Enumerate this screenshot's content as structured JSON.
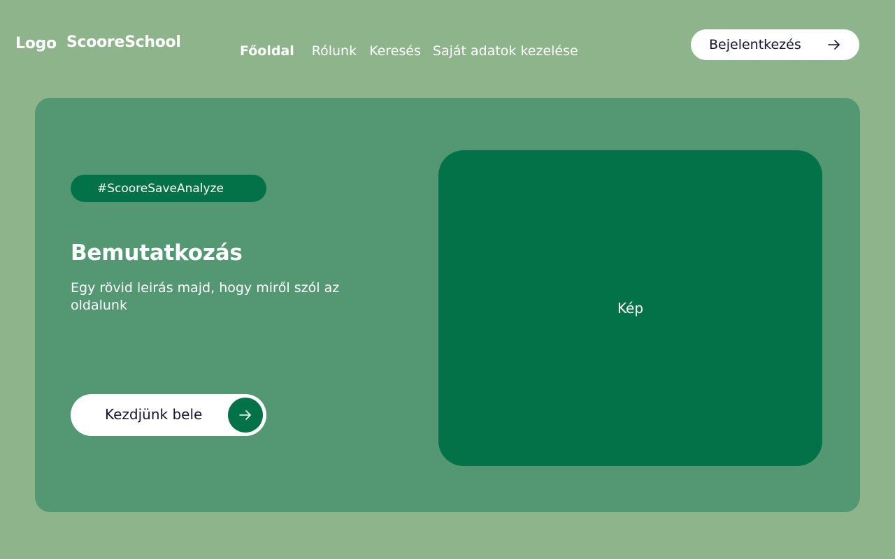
{
  "header": {
    "logo": "Logo",
    "brand": "ScooreSchool",
    "nav": {
      "home": "Főoldal",
      "about": "Rólunk",
      "search": "Keresés",
      "profile": "Saját adatok kezelése"
    },
    "login_label": "Bejelentkezés",
    "login_icon": "arrow-right-icon"
  },
  "hero": {
    "tag": "#ScooreSaveAnalyze",
    "title": "Bemutatkozás",
    "description": "Egy rövid leirás majd, hogy miről szól az oldalunk",
    "cta_label": "Kezdjünk bele",
    "cta_icon": "arrow-right-icon",
    "image_placeholder": "Kép"
  },
  "colors": {
    "page_background": "#8db48b",
    "card_background": "#539873",
    "accent": "#047249",
    "button_background": "#ffffff",
    "button_text": "#141432"
  }
}
